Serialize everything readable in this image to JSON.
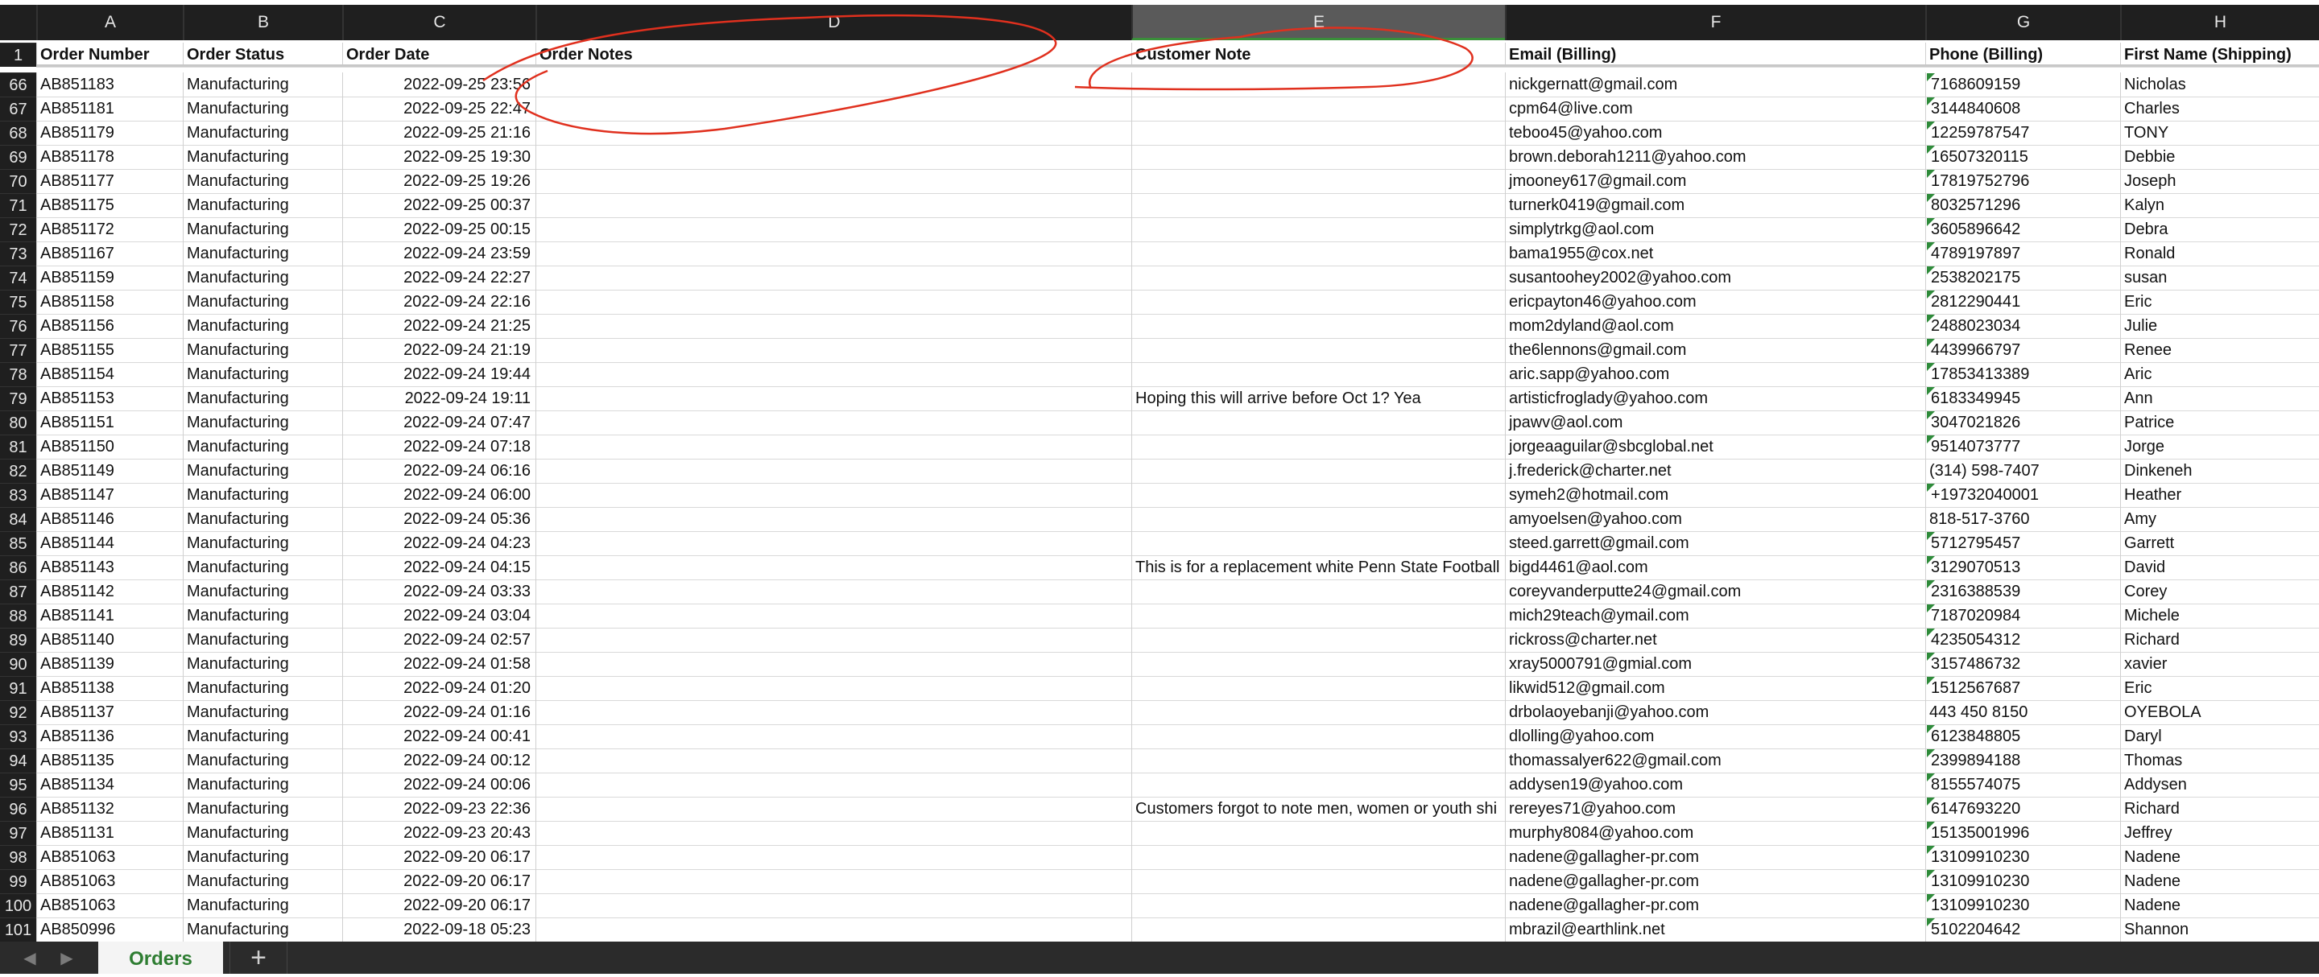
{
  "columns": [
    {
      "letter": "A"
    },
    {
      "letter": "B"
    },
    {
      "letter": "C"
    },
    {
      "letter": "D"
    },
    {
      "letter": "E",
      "selected": true
    },
    {
      "letter": "F"
    },
    {
      "letter": "G"
    },
    {
      "letter": "H"
    }
  ],
  "header_row": {
    "row_number": "1",
    "cells": [
      "Order Number",
      "Order Status",
      "Order Date",
      "Order Notes",
      "Customer Note",
      "Email (Billing)",
      "Phone (Billing)",
      "First Name (Shipping)"
    ]
  },
  "rows": [
    {
      "n": "66",
      "num": "AB851183",
      "status": "Manufacturing",
      "date": "2022-09-25 23:56",
      "notes": "",
      "cnote": "",
      "email": "nickgernatt@gmail.com",
      "phone": "7168609159",
      "phone_flag": true,
      "first": "Nicholas"
    },
    {
      "n": "67",
      "num": "AB851181",
      "status": "Manufacturing",
      "date": "2022-09-25 22:47",
      "notes": "",
      "cnote": "",
      "email": "cpm64@live.com",
      "phone": "3144840608",
      "phone_flag": true,
      "first": "Charles"
    },
    {
      "n": "68",
      "num": "AB851179",
      "status": "Manufacturing",
      "date": "2022-09-25 21:16",
      "notes": "",
      "cnote": "",
      "email": "teboo45@yahoo.com",
      "phone": "12259787547",
      "phone_flag": true,
      "first": "TONY"
    },
    {
      "n": "69",
      "num": "AB851178",
      "status": "Manufacturing",
      "date": "2022-09-25 19:30",
      "notes": "",
      "cnote": "",
      "email": "brown.deborah1211@yahoo.com",
      "phone": "16507320115",
      "phone_flag": true,
      "first": "Debbie"
    },
    {
      "n": "70",
      "num": "AB851177",
      "status": "Manufacturing",
      "date": "2022-09-25 19:26",
      "notes": "",
      "cnote": "",
      "email": "jmooney617@gmail.com",
      "phone": "17819752796",
      "phone_flag": true,
      "first": "Joseph"
    },
    {
      "n": "71",
      "num": "AB851175",
      "status": "Manufacturing",
      "date": "2022-09-25 00:37",
      "notes": "",
      "cnote": "",
      "email": "turnerk0419@gmail.com",
      "phone": "8032571296",
      "phone_flag": true,
      "first": "Kalyn"
    },
    {
      "n": "72",
      "num": "AB851172",
      "status": "Manufacturing",
      "date": "2022-09-25 00:15",
      "notes": "",
      "cnote": "",
      "email": "simplytrkg@aol.com",
      "phone": "3605896642",
      "phone_flag": true,
      "first": "Debra"
    },
    {
      "n": "73",
      "num": "AB851167",
      "status": "Manufacturing",
      "date": "2022-09-24 23:59",
      "notes": "",
      "cnote": "",
      "email": "bama1955@cox.net",
      "phone": "4789197897",
      "phone_flag": true,
      "first": "Ronald"
    },
    {
      "n": "74",
      "num": "AB851159",
      "status": "Manufacturing",
      "date": "2022-09-24 22:27",
      "notes": "",
      "cnote": "",
      "email": "susantoohey2002@yahoo.com",
      "phone": "2538202175",
      "phone_flag": true,
      "first": "susan"
    },
    {
      "n": "75",
      "num": "AB851158",
      "status": "Manufacturing",
      "date": "2022-09-24 22:16",
      "notes": "",
      "cnote": "",
      "email": "ericpayton46@yahoo.com",
      "phone": "2812290441",
      "phone_flag": true,
      "first": "Eric"
    },
    {
      "n": "76",
      "num": "AB851156",
      "status": "Manufacturing",
      "date": "2022-09-24 21:25",
      "notes": "",
      "cnote": "",
      "email": "mom2dyland@aol.com",
      "phone": "2488023034",
      "phone_flag": true,
      "first": "Julie"
    },
    {
      "n": "77",
      "num": "AB851155",
      "status": "Manufacturing",
      "date": "2022-09-24 21:19",
      "notes": "",
      "cnote": "",
      "email": "the6lennons@gmail.com",
      "phone": "4439966797",
      "phone_flag": true,
      "first": "Renee"
    },
    {
      "n": "78",
      "num": "AB851154",
      "status": "Manufacturing",
      "date": "2022-09-24 19:44",
      "notes": "",
      "cnote": "",
      "email": "aric.sapp@yahoo.com",
      "phone": "17853413389",
      "phone_flag": true,
      "first": "Aric"
    },
    {
      "n": "79",
      "num": "AB851153",
      "status": "Manufacturing",
      "date": "2022-09-24 19:11",
      "notes": "",
      "cnote": "Hoping this will arrive before Oct 1? Yea",
      "email": "artisticfroglady@yahoo.com",
      "phone": "6183349945",
      "phone_flag": true,
      "first": "Ann"
    },
    {
      "n": "80",
      "num": "AB851151",
      "status": "Manufacturing",
      "date": "2022-09-24 07:47",
      "notes": "",
      "cnote": "",
      "email": "jpawv@aol.com",
      "phone": "3047021826",
      "phone_flag": true,
      "first": "Patrice"
    },
    {
      "n": "81",
      "num": "AB851150",
      "status": "Manufacturing",
      "date": "2022-09-24 07:18",
      "notes": "",
      "cnote": "",
      "email": "jorgeaaguilar@sbcglobal.net",
      "phone": "9514073777",
      "phone_flag": true,
      "first": "Jorge"
    },
    {
      "n": "82",
      "num": "AB851149",
      "status": "Manufacturing",
      "date": "2022-09-24 06:16",
      "notes": "",
      "cnote": "",
      "email": "j.frederick@charter.net",
      "phone": "(314) 598-7407",
      "phone_flag": false,
      "first": "Dinkeneh"
    },
    {
      "n": "83",
      "num": "AB851147",
      "status": "Manufacturing",
      "date": "2022-09-24 06:00",
      "notes": "",
      "cnote": "",
      "email": "symeh2@hotmail.com",
      "phone": "+19732040001",
      "phone_flag": true,
      "first": "Heather"
    },
    {
      "n": "84",
      "num": "AB851146",
      "status": "Manufacturing",
      "date": "2022-09-24 05:36",
      "notes": "",
      "cnote": "",
      "email": "amyoelsen@yahoo.com",
      "phone": "818-517-3760",
      "phone_flag": false,
      "first": "Amy"
    },
    {
      "n": "85",
      "num": "AB851144",
      "status": "Manufacturing",
      "date": "2022-09-24 04:23",
      "notes": "",
      "cnote": "",
      "email": "steed.garrett@gmail.com",
      "phone": "5712795457",
      "phone_flag": true,
      "first": "Garrett"
    },
    {
      "n": "86",
      "num": "AB851143",
      "status": "Manufacturing",
      "date": "2022-09-24 04:15",
      "notes": "",
      "cnote": "This is for a replacement white Penn State Football ...",
      "email": "bigd4461@aol.com",
      "phone": "3129070513",
      "phone_flag": true,
      "first": "David"
    },
    {
      "n": "87",
      "num": "AB851142",
      "status": "Manufacturing",
      "date": "2022-09-24 03:33",
      "notes": "",
      "cnote": "",
      "email": "coreyvanderputte24@gmail.com",
      "phone": "2316388539",
      "phone_flag": true,
      "first": "Corey"
    },
    {
      "n": "88",
      "num": "AB851141",
      "status": "Manufacturing",
      "date": "2022-09-24 03:04",
      "notes": "",
      "cnote": "",
      "email": "mich29teach@ymail.com",
      "phone": "7187020984",
      "phone_flag": true,
      "first": "Michele"
    },
    {
      "n": "89",
      "num": "AB851140",
      "status": "Manufacturing",
      "date": "2022-09-24 02:57",
      "notes": "",
      "cnote": "",
      "email": "rickross@charter.net",
      "phone": "4235054312",
      "phone_flag": true,
      "first": "Richard"
    },
    {
      "n": "90",
      "num": "AB851139",
      "status": "Manufacturing",
      "date": "2022-09-24 01:58",
      "notes": "",
      "cnote": "",
      "email": "xray5000791@gmial.com",
      "phone": "3157486732",
      "phone_flag": true,
      "first": "xavier"
    },
    {
      "n": "91",
      "num": "AB851138",
      "status": "Manufacturing",
      "date": "2022-09-24 01:20",
      "notes": "",
      "cnote": "",
      "email": "likwid512@gmail.com",
      "phone": "1512567687",
      "phone_flag": true,
      "first": "Eric"
    },
    {
      "n": "92",
      "num": "AB851137",
      "status": "Manufacturing",
      "date": "2022-09-24 01:16",
      "notes": "",
      "cnote": "",
      "email": "drbolaoyebanji@yahoo.com",
      "phone": "443 450 8150",
      "phone_flag": false,
      "first": "OYEBOLA"
    },
    {
      "n": "93",
      "num": "AB851136",
      "status": "Manufacturing",
      "date": "2022-09-24 00:41",
      "notes": "",
      "cnote": "",
      "email": "dlolling@yahoo.com",
      "phone": "6123848805",
      "phone_flag": true,
      "first": "Daryl"
    },
    {
      "n": "94",
      "num": "AB851135",
      "status": "Manufacturing",
      "date": "2022-09-24 00:12",
      "notes": "",
      "cnote": "",
      "email": "thomassalyer622@gmail.com",
      "phone": "2399894188",
      "phone_flag": true,
      "first": "Thomas"
    },
    {
      "n": "95",
      "num": "AB851134",
      "status": "Manufacturing",
      "date": "2022-09-24 00:06",
      "notes": "",
      "cnote": "",
      "email": "addysen19@yahoo.com",
      "phone": "8155574075",
      "phone_flag": true,
      "first": "Addysen"
    },
    {
      "n": "96",
      "num": "AB851132",
      "status": "Manufacturing",
      "date": "2022-09-23 22:36",
      "notes": "",
      "cnote": "Customers forgot to note men, women or youth shi",
      "email": "rereyes71@yahoo.com",
      "phone": "6147693220",
      "phone_flag": true,
      "first": "Richard"
    },
    {
      "n": "97",
      "num": "AB851131",
      "status": "Manufacturing",
      "date": "2022-09-23 20:43",
      "notes": "",
      "cnote": "",
      "email": "murphy8084@yahoo.com",
      "phone": "15135001996",
      "phone_flag": true,
      "first": "Jeffrey"
    },
    {
      "n": "98",
      "num": "AB851063",
      "status": "Manufacturing",
      "date": "2022-09-20 06:17",
      "notes": "",
      "cnote": "",
      "email": "nadene@gallagher-pr.com",
      "phone": "13109910230",
      "phone_flag": true,
      "first": "Nadene"
    },
    {
      "n": "99",
      "num": "AB851063",
      "status": "Manufacturing",
      "date": "2022-09-20 06:17",
      "notes": "",
      "cnote": "",
      "email": "nadene@gallagher-pr.com",
      "phone": "13109910230",
      "phone_flag": true,
      "first": "Nadene"
    },
    {
      "n": "100",
      "num": "AB851063",
      "status": "Manufacturing",
      "date": "2022-09-20 06:17",
      "notes": "",
      "cnote": "",
      "email": "nadene@gallagher-pr.com",
      "phone": "13109910230",
      "phone_flag": true,
      "first": "Nadene"
    },
    {
      "n": "101",
      "num": "AB850996",
      "status": "Manufacturing",
      "date": "2022-09-18 05:23",
      "notes": "",
      "cnote": "",
      "email": "mbrazil@earthlink.net",
      "phone": "5102204642",
      "phone_flag": true,
      "first": "Shannon"
    }
  ],
  "tabs": {
    "active": "Orders",
    "add_label": "+",
    "prev_icon": "chevron-left-icon",
    "next_icon": "chevron-right-icon"
  },
  "colors": {
    "accent": "#2e7d32",
    "annotation": "#e0301e",
    "header_bg": "#1f1f1f"
  }
}
